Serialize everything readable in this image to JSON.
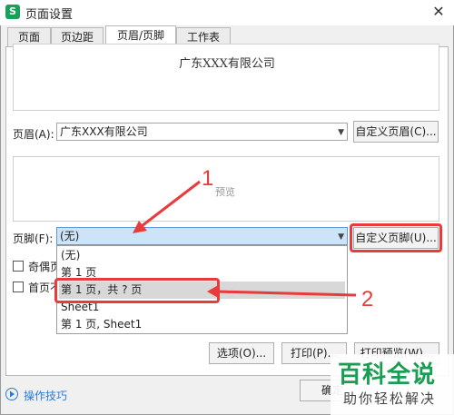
{
  "window": {
    "title": "页面设置",
    "app_icon_letter": "S",
    "close_symbol": "✕"
  },
  "tabs": [
    {
      "label": "页面"
    },
    {
      "label": "页边距"
    },
    {
      "label": "页眉/页脚",
      "active": true
    },
    {
      "label": "工作表"
    }
  ],
  "header": {
    "preview_text": "广东XXX有限公司",
    "label": "页眉(A):",
    "selected_value": "广东XXX有限公司",
    "custom_button": "自定义页眉(C)..."
  },
  "footer": {
    "preview_text": "预览",
    "label": "页脚(F):",
    "selected_value": "(无)",
    "custom_button": "自定义页脚(U)...",
    "options": [
      {
        "label": "(无)"
      },
      {
        "label": "第 1 页"
      },
      {
        "label": "第 1 页，共 ? 页",
        "highlighted": true
      },
      {
        "label": "Sheet1"
      },
      {
        "label": "第 1 页, Sheet1"
      }
    ]
  },
  "checkboxes": [
    {
      "label": "奇偶页不同"
    },
    {
      "label": "首页不同"
    }
  ],
  "buttons": {
    "options": "选项(O)...",
    "print": "打印(P)...",
    "print_preview": "打印预览(W)...",
    "ok": "确定"
  },
  "tips": {
    "label": "操作技巧"
  },
  "annotations": {
    "one": "1",
    "two": "2",
    "color": "#e83c3c"
  },
  "watermark": {
    "title": "百科全说",
    "subtitle": "助你轻松解决"
  }
}
